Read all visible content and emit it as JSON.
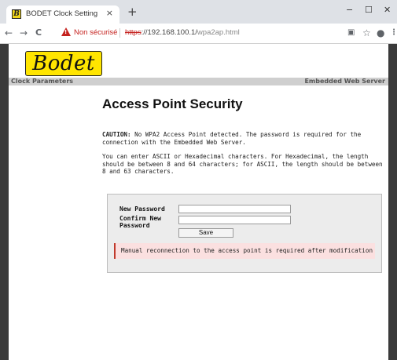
{
  "browser": {
    "tab": {
      "favicon_letter": "B",
      "title": "BODET Clock Setting",
      "close": "×"
    },
    "new_tab": "+",
    "window_controls": {
      "minimize": "−",
      "maximize": "☐",
      "close": "✕"
    },
    "nav": {
      "back": "←",
      "forward": "→",
      "reload": "C"
    },
    "security_label": "Non sécurisé",
    "url": {
      "scheme": "https",
      "rest": "://192.168.100.1/",
      "path": "wpa2ap.html"
    },
    "toolbar_icons": [
      "translate-icon",
      "star-icon",
      "account-icon",
      "menu-icon"
    ],
    "toolbar_glyphs": {
      "translate": "▣",
      "star": "☆",
      "account": "●",
      "menu": "⋮"
    }
  },
  "page": {
    "logo_text": "Bodet",
    "header_left": "Clock Parameters",
    "header_right": "Embedded Web Server",
    "title": "Access Point Security",
    "caution_label": "CAUTION:",
    "caution_text": " No WPA2 Access Point detected. The password is required for the connection with the Embedded Web Server.",
    "info_text": "You can enter ASCII or Hexadecimal characters. For Hexadecimal, the length should be between 8 and 64 characters; for ASCII, the length should be between 8 and 63 characters.",
    "form": {
      "new_password_label": "New Password",
      "confirm_label_line1": "Confirm New",
      "confirm_label_line2": "Password",
      "new_password_value": "",
      "confirm_value": "",
      "save_label": "Save",
      "notice": "Manual reconnection to the access point is required after modification"
    }
  },
  "colors": {
    "logo_bg": "#ffe500",
    "warning_red": "#c5221f",
    "notice_bg": "#fbe0e0",
    "notice_border": "#c0392b"
  }
}
